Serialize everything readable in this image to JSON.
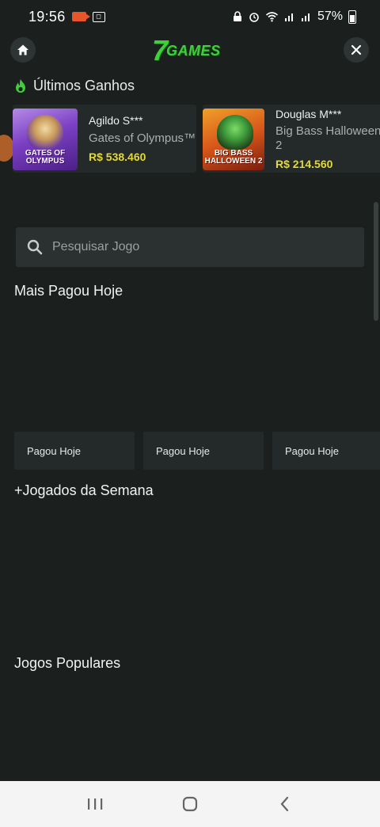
{
  "status_bar": {
    "time": "19:56",
    "battery": "57%"
  },
  "header": {
    "logo_seven": "7",
    "logo_text": "GAMES",
    "accent_color": "#3ecf3a"
  },
  "ultimos_ganhos": {
    "title": "Últimos Ganhos",
    "winners": [
      {
        "name": "Agildo S***",
        "game": "Gates of Olympus™",
        "amount": "R$ 538.460",
        "thumb_text": "GATES OF OLYMPUS"
      },
      {
        "name": "Douglas M***",
        "game": "Big Bass Halloween 2",
        "amount": "R$ 214.560",
        "thumb_text": "BIG BASS HALLOWEEN 2"
      }
    ]
  },
  "search": {
    "placeholder": "Pesquisar Jogo"
  },
  "sections": {
    "mais_pagou": "Mais Pagou Hoje",
    "pago_cards": [
      "Pagou Hoje",
      "Pagou Hoje",
      "Pagou Hoje"
    ],
    "jogados_semana": "+Jogados da Semana",
    "jogos_populares": "Jogos Populares"
  },
  "icons": {
    "home": "home-icon",
    "close": "close-icon",
    "search": "search-icon",
    "flame": "flame-icon"
  }
}
